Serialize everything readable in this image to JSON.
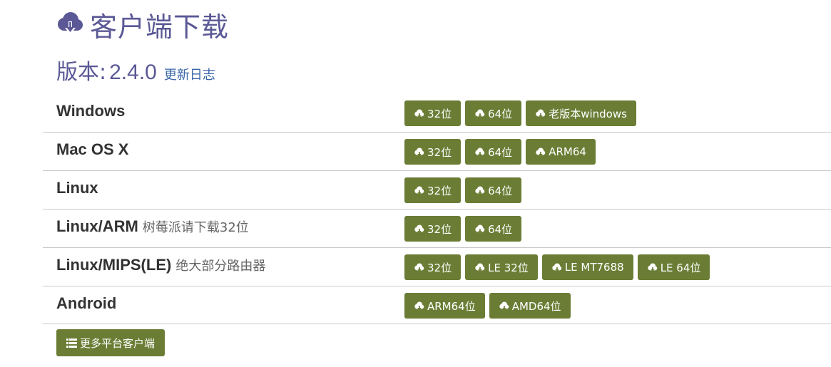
{
  "header": {
    "title": "客户端下载",
    "title_icon": "cloud-download-icon",
    "version_label": "版本:",
    "version_number": "2.4.0",
    "changelog_link": "更新日志"
  },
  "colors": {
    "heading": "#5a5895",
    "link": "#3a66a8",
    "button_bg": "#6b7d35",
    "button_text": "#ffffff",
    "divider": "#c8c8c8"
  },
  "platforms": [
    {
      "name": "Windows",
      "note": "",
      "buttons": [
        "32位",
        "64位",
        "老版本windows"
      ]
    },
    {
      "name": "Mac OS X",
      "note": "",
      "buttons": [
        "32位",
        "64位",
        "ARM64"
      ]
    },
    {
      "name": "Linux",
      "note": "",
      "buttons": [
        "32位",
        "64位"
      ]
    },
    {
      "name": "Linux/ARM",
      "note": "树莓派请下载32位",
      "buttons": [
        "32位",
        "64位"
      ]
    },
    {
      "name": "Linux/MIPS(LE)",
      "note": "绝大部分路由器",
      "buttons": [
        "32位",
        "LE 32位",
        "LE MT7688",
        "LE 64位"
      ]
    },
    {
      "name": "Android",
      "note": "",
      "buttons": [
        "ARM64位",
        "AMD64位"
      ]
    }
  ],
  "button_icon": "cloud-download-icon",
  "more_button": {
    "label": "更多平台客户端",
    "icon": "list-icon"
  }
}
